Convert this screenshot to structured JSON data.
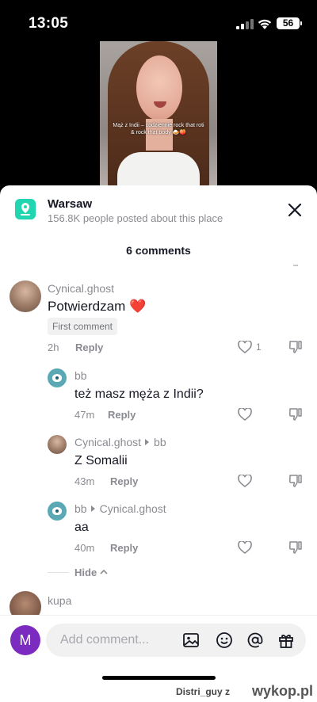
{
  "status_bar": {
    "time": "13:05",
    "battery": "56"
  },
  "video": {
    "caption": "Mąż z Indii – codziennie rock that roti & rock that body 🍛🍑"
  },
  "place": {
    "name": "Warsaw",
    "subtitle": "156.8K people posted about this place"
  },
  "comments_header": "6 comments",
  "comments": [
    {
      "user": "Cynical.ghost",
      "text": "Potwierdzam ❤️",
      "badge": "First comment",
      "time": "2h",
      "reply": "Reply",
      "likes": "1"
    },
    {
      "user": "bb",
      "text": "też masz męża z Indii?",
      "time": "47m",
      "reply": "Reply"
    },
    {
      "user": "Cynical.ghost",
      "reply_to": "bb",
      "text": "Z Somalii",
      "time": "43m",
      "reply": "Reply"
    },
    {
      "user": "bb",
      "reply_to": "Cynical.ghost",
      "text": "aa",
      "time": "40m",
      "reply": "Reply"
    },
    {
      "user": "kupa"
    }
  ],
  "hide_label": "Hide",
  "input": {
    "avatar_letter": "M",
    "placeholder": "Add comment..."
  },
  "watermark": {
    "user": "Distri_guy",
    "z": "z",
    "site": "wykop.pl"
  },
  "icons": [
    "location-pin-icon",
    "close-icon",
    "heart-icon",
    "dislike-icon",
    "image-icon",
    "emoji-icon",
    "at-icon",
    "gift-icon",
    "chevron-up-icon"
  ]
}
